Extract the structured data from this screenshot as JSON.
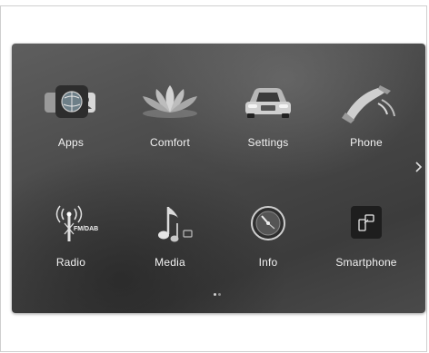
{
  "home_screen": {
    "apps": [
      {
        "label": "Apps",
        "icon": "apps-icon"
      },
      {
        "label": "Comfort",
        "icon": "lotus-icon"
      },
      {
        "label": "Settings",
        "icon": "car-icon"
      },
      {
        "label": "Phone",
        "icon": "phone-handset-icon"
      },
      {
        "label": "Radio",
        "icon": "radio-antenna-icon",
        "icon_caption": "FM/DAB"
      },
      {
        "label": "Media",
        "icon": "music-note-icon"
      },
      {
        "label": "Info",
        "icon": "info-dial-icon"
      },
      {
        "label": "Smartphone",
        "icon": "smartphone-icon"
      }
    ],
    "pager": {
      "pages": 2,
      "current": 1
    }
  }
}
